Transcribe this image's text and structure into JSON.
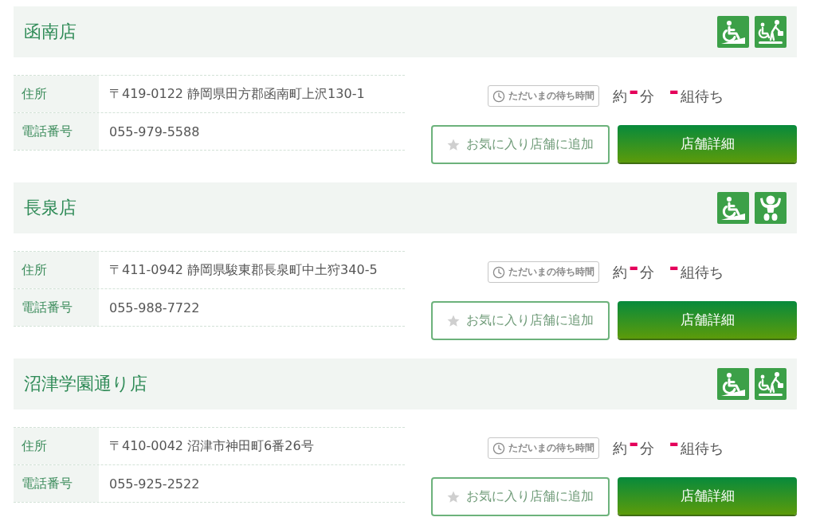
{
  "stores": [
    {
      "name": "函南店",
      "facilities": [
        {
          "kind": "wheelchair"
        },
        {
          "kind": "toilet"
        }
      ],
      "info": [
        {
          "label": "住所",
          "value": "〒419-0122 静岡県田方郡函南町上沢130-1"
        },
        {
          "label": "電話番号",
          "value": "055-979-5588"
        }
      ],
      "wait_badge": "ただいまの待ち時間",
      "wait_minutes": {
        "prefix": "約",
        "value": "-",
        "unit": "分"
      },
      "wait_groups": {
        "value": "-",
        "unit": "組待ち"
      },
      "favorite_button": "お気に入り店舗に追加",
      "detail_button": "店舗詳細"
    },
    {
      "name": "長泉店",
      "facilities": [
        {
          "kind": "wheelchair"
        },
        {
          "kind": "baby"
        }
      ],
      "info": [
        {
          "label": "住所",
          "value": "〒411-0942 静岡県駿東郡長泉町中土狩340-5"
        },
        {
          "label": "電話番号",
          "value": "055-988-7722"
        }
      ],
      "wait_badge": "ただいまの待ち時間",
      "wait_minutes": {
        "prefix": "約",
        "value": "-",
        "unit": "分"
      },
      "wait_groups": {
        "value": "-",
        "unit": "組待ち"
      },
      "favorite_button": "お気に入り店舗に追加",
      "detail_button": "店舗詳細"
    },
    {
      "name": "沼津学園通り店",
      "facilities": [
        {
          "kind": "wheelchair"
        },
        {
          "kind": "toilet"
        }
      ],
      "info": [
        {
          "label": "住所",
          "value": "〒410-0042 沼津市神田町6番26号"
        },
        {
          "label": "電話番号",
          "value": "055-925-2522"
        }
      ],
      "wait_badge": "ただいまの待ち時間",
      "wait_minutes": {
        "prefix": "約",
        "value": "-",
        "unit": "分"
      },
      "wait_groups": {
        "value": "-",
        "unit": "組待ち"
      },
      "favorite_button": "お気に入り店舗に追加",
      "detail_button": "店舗詳細"
    }
  ]
}
